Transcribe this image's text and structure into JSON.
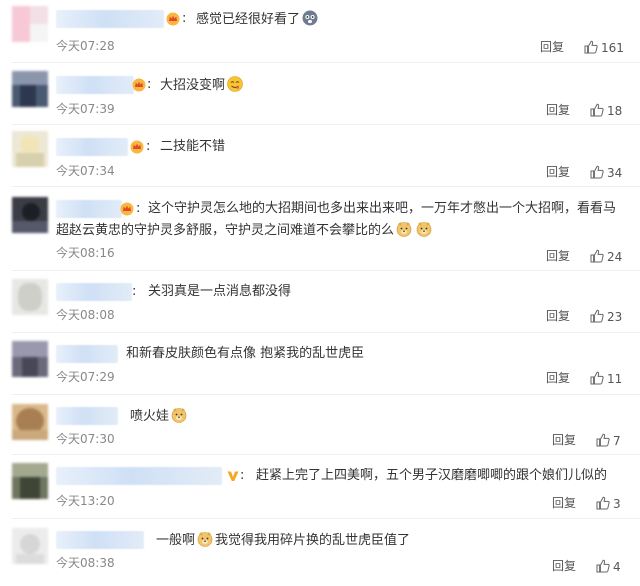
{
  "reply_label": "回复",
  "comments": [
    {
      "text": "感觉已经很好看了",
      "time": "今天07:28",
      "likes": "161",
      "emojis": [
        "scared-face-emoji"
      ]
    },
    {
      "text": "大招没变啊",
      "time": "今天07:39",
      "likes": "18",
      "emojis": [
        "yum-face-emoji"
      ]
    },
    {
      "text": "二技能不错",
      "time": "今天07:34",
      "likes": "34",
      "emojis": []
    },
    {
      "text": "这个守护灵怎么地的大招期间也多出来出来吧，一万年才憋出一个大招啊，看看马超赵云黄忠的守护灵多舒服，守护灵之间难道不会攀比的么",
      "time": "今天08:16",
      "likes": "24",
      "emojis": [
        "doge-emoji",
        "doge-emoji"
      ]
    },
    {
      "text": "关羽真是一点消息都没得",
      "time": "今天08:08",
      "likes": "23",
      "emojis": []
    },
    {
      "text": "和新春皮肤颜色有点像 抱紧我的乱世虎臣",
      "time": "今天07:29",
      "likes": "11",
      "emojis": []
    },
    {
      "text": "喷火娃",
      "time": "今天07:30",
      "likes": "7",
      "emojis": [
        "doge-emoji"
      ]
    },
    {
      "text": "赶紧上完了上四美啊，五个男子汉磨磨唧唧的跟个娘们儿似的",
      "time": "今天13:20",
      "likes": "3",
      "emojis": []
    },
    {
      "text_before": "一般啊",
      "text_after": "我觉得我用碎片换的乱世虎臣值了",
      "time": "今天08:38",
      "likes": "4",
      "emojis": [
        "doge-emoji"
      ]
    }
  ]
}
